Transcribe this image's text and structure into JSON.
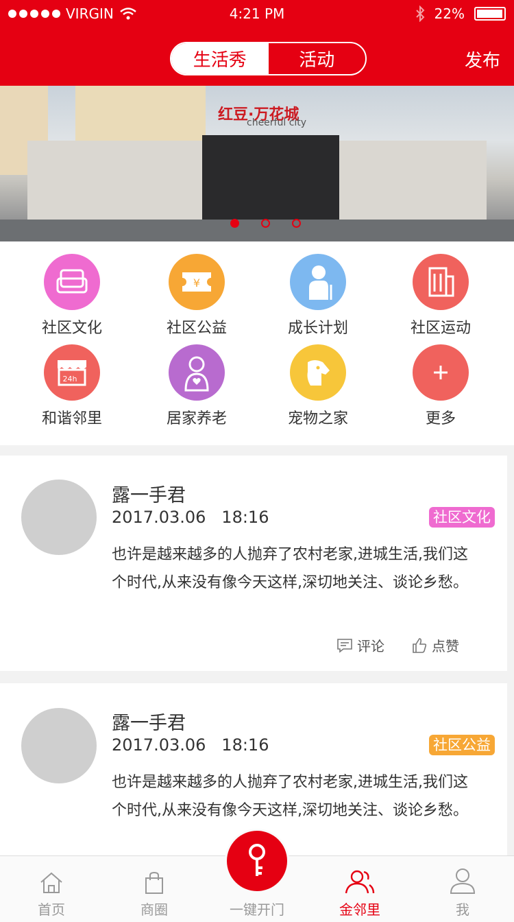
{
  "status_bar": {
    "carrier": "VIRGIN",
    "time": "4:21 PM",
    "battery": "22%"
  },
  "header": {
    "tabs": [
      "生活秀",
      "活动"
    ],
    "active_tab": 0,
    "publish_label": "发布"
  },
  "banner": {
    "sign_text": "红豆·万花城",
    "sign_subtext": "cheerful city",
    "slide_count": 3,
    "active_slide": 0
  },
  "categories": [
    {
      "label": "社区文化",
      "icon": "sofa-icon",
      "color": "#ef6bd0"
    },
    {
      "label": "社区公益",
      "icon": "ticket-icon",
      "color": "#f7a735"
    },
    {
      "label": "成长计划",
      "icon": "elder-person-icon",
      "color": "#7db8f0"
    },
    {
      "label": "社区运动",
      "icon": "building-icon",
      "color": "#f0625d"
    },
    {
      "label": "和谐邻里",
      "icon": "store-24h-icon",
      "color": "#f0625d"
    },
    {
      "label": "居家养老",
      "icon": "caregiver-icon",
      "color": "#b86bcf"
    },
    {
      "label": "宠物之家",
      "icon": "dog-icon",
      "color": "#f7c63a"
    },
    {
      "label": "更多",
      "icon": "plus-icon",
      "color": "#f0625d"
    }
  ],
  "posts": [
    {
      "username": "露一手君",
      "time": "2017.03.06   18:16",
      "tag": "社区文化",
      "tag_color": "#ef6bd0",
      "text": "也许是越来越多的人抛弃了农村老家,进城生活,我们这个时代,从来没有像今天这样,深切地关注、谈论乡愁。",
      "comment_label": "评论",
      "like_label": "点赞"
    },
    {
      "username": "露一手君",
      "time": "2017.03.06   18:16",
      "tag": "社区公益",
      "tag_color": "#f7a735",
      "text": "也许是越来越多的人抛弃了农村老家,进城生活,我们这个时代,从来没有像今天这样,深切地关注、谈论乡愁。"
    }
  ],
  "tabbar": {
    "items": [
      {
        "label": "首页",
        "icon": "home-icon"
      },
      {
        "label": "商圈",
        "icon": "shopping-bag-icon"
      },
      {
        "label": "一键开门",
        "icon": "key-icon"
      },
      {
        "label": "金邻里",
        "icon": "neighbors-icon"
      },
      {
        "label": "我",
        "icon": "user-icon"
      }
    ],
    "active_index": 3
  },
  "colors": {
    "brand": "#e50012",
    "avatar_placeholder": "#cfcfcf"
  }
}
